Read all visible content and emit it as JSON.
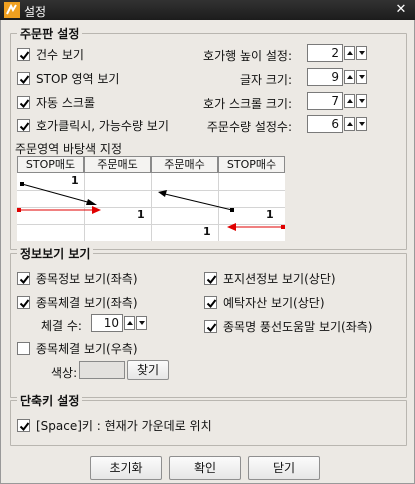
{
  "window": {
    "title": "설정",
    "close_glyph": "✕"
  },
  "order_panel": {
    "title": "주문판 설정",
    "checkboxes": [
      {
        "label": "건수 보기",
        "checked": true
      },
      {
        "label": "STOP 영역 보기",
        "checked": true
      },
      {
        "label": "자동 스크롤",
        "checked": true
      },
      {
        "label": "호가클릭시, 가능수량 보기",
        "checked": true
      }
    ],
    "spinners": [
      {
        "label": "호가행 높이 설정:",
        "value": "2"
      },
      {
        "label": "글자 크기:",
        "value": "9"
      },
      {
        "label": "호가 스크롤 크기:",
        "value": "7"
      },
      {
        "label": "주문수량 설정수:",
        "value": "6"
      }
    ],
    "bg_color_label": "주문영역 바탕색 지정",
    "headers": [
      "STOP매도",
      "주문매도",
      "주문매수",
      "STOP매수"
    ],
    "preview_numbers": [
      "1",
      "1",
      "1",
      "1"
    ],
    "colors": {
      "red_arrow": "#e00000",
      "black_arrow": "#000000"
    }
  },
  "info_panel": {
    "title": "정보보기 보기",
    "left_checkboxes": [
      {
        "label": "종목정보 보기(좌측)",
        "checked": true
      },
      {
        "label": "종목체결 보기(좌측)",
        "checked": true
      }
    ],
    "exec_count_label": "체결 수:",
    "exec_count_value": "10",
    "right_side_checkbox": {
      "label": "종목체결 보기(우측)",
      "checked": false
    },
    "color_label": "색상:",
    "find_button": "찾기",
    "right_checkboxes": [
      {
        "label": "포지션정보 보기(상단)",
        "checked": true
      },
      {
        "label": "예탁자산 보기(상단)",
        "checked": true
      },
      {
        "label": "종목명 풍선도움말 보기(좌측)",
        "checked": true
      }
    ]
  },
  "shortcut_panel": {
    "title": "단축키 설정",
    "checkbox": {
      "label": "[Space]키 : 현재가 가운데로 위치",
      "checked": true
    }
  },
  "footer": {
    "reset": "초기화",
    "ok": "확인",
    "close": "닫기"
  }
}
